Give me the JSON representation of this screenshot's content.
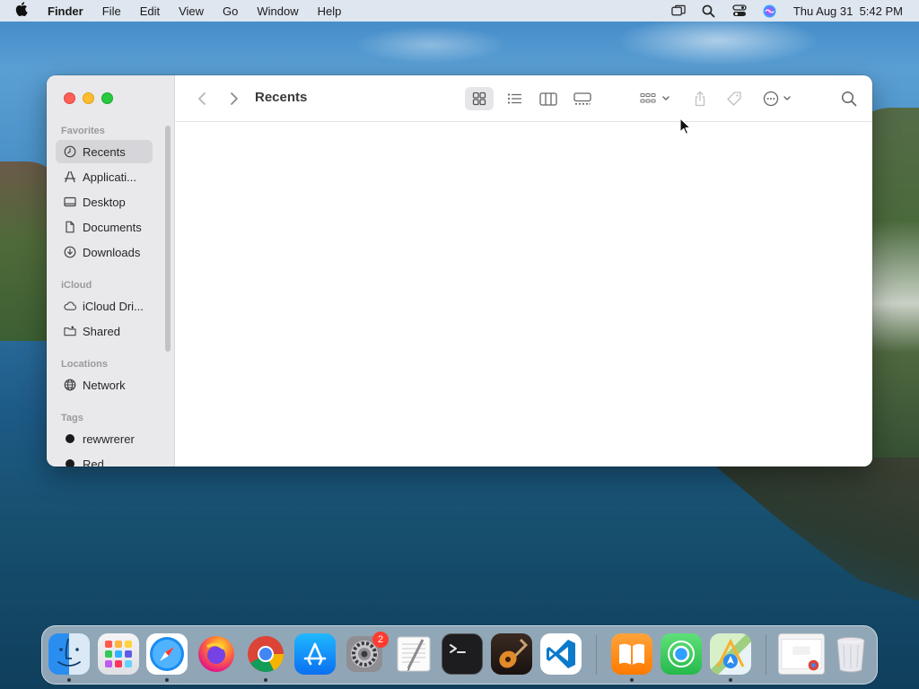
{
  "menubar": {
    "app_name": "Finder",
    "items": [
      "File",
      "Edit",
      "View",
      "Go",
      "Window",
      "Help"
    ],
    "datetime": "Thu Aug 31  5:42 PM",
    "status_icons": [
      "screen-mirroring-icon",
      "spotlight-icon",
      "control-center-icon",
      "siri-icon"
    ]
  },
  "window": {
    "title": "Recents",
    "sidebar": {
      "favorites_header": "Favorites",
      "favorites": [
        {
          "label": "Recents",
          "icon": "clock-icon",
          "selected": true
        },
        {
          "label": "Applicati...",
          "icon": "applications-icon"
        },
        {
          "label": "Desktop",
          "icon": "desktop-icon"
        },
        {
          "label": "Documents",
          "icon": "document-icon"
        },
        {
          "label": "Downloads",
          "icon": "download-icon"
        }
      ],
      "icloud_header": "iCloud",
      "icloud": [
        {
          "label": "iCloud Dri...",
          "icon": "cloud-icon"
        },
        {
          "label": "Shared",
          "icon": "shared-folder-icon"
        }
      ],
      "locations_header": "Locations",
      "locations": [
        {
          "label": "Network",
          "icon": "globe-icon"
        }
      ],
      "tags_header": "Tags",
      "tags": [
        {
          "label": "rewwrerer",
          "color": "#1a1a1a"
        },
        {
          "label": "Red",
          "color": "#1a1a1a"
        }
      ]
    },
    "toolbar": [
      "back-icon",
      "forward-icon",
      "icon-view-icon",
      "list-view-icon",
      "column-view-icon",
      "gallery-view-icon",
      "group-by-icon",
      "share-icon",
      "tag-icon",
      "more-actions-icon",
      "search-icon"
    ]
  },
  "dock": {
    "apps": [
      "Finder",
      "Launchpad",
      "Safari",
      "Firefox",
      "Google Chrome",
      "App Store",
      "System Settings",
      "TextEdit",
      "Terminal",
      "GarageBand",
      "Visual Studio Code",
      "Books",
      "Find My",
      "Maps",
      "Chrome window",
      "Trash"
    ],
    "settings_badge": "2"
  }
}
